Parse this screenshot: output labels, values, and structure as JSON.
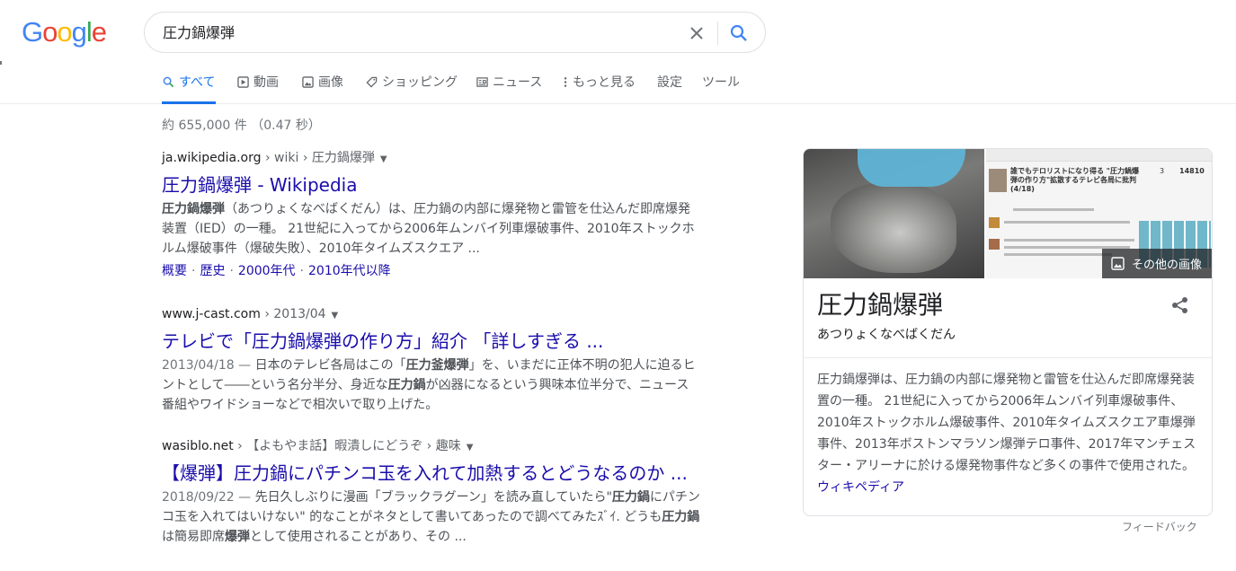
{
  "logo": {
    "letters": [
      {
        "ch": "G",
        "color": "#4285F4"
      },
      {
        "ch": "o",
        "color": "#EA4335"
      },
      {
        "ch": "o",
        "color": "#FBBC05"
      },
      {
        "ch": "g",
        "color": "#4285F4"
      },
      {
        "ch": "l",
        "color": "#34A853"
      },
      {
        "ch": "e",
        "color": "#EA4335"
      }
    ]
  },
  "search": {
    "query": "圧力鍋爆弾",
    "clear_icon": "close-icon",
    "search_icon": "search-icon"
  },
  "tabs": [
    {
      "label": "すべて",
      "icon": "search-icon",
      "active": true
    },
    {
      "label": "動画",
      "icon": "video-icon"
    },
    {
      "label": "画像",
      "icon": "image-icon"
    },
    {
      "label": "ショッピング",
      "icon": "tag-icon"
    },
    {
      "label": "ニュース",
      "icon": "news-icon"
    },
    {
      "label": "もっと見る",
      "icon": "more-vert-icon"
    },
    {
      "label": "設定"
    },
    {
      "label": "ツール"
    }
  ],
  "stats": "約 655,000 件 （0.47 秒）",
  "results": [
    {
      "domain": "ja.wikipedia.org",
      "path": " › wiki › 圧力鍋爆弾",
      "title": "圧力鍋爆弾 - Wikipedia",
      "snippet_bold": "圧力鍋爆弾",
      "snippet_rest": "（あつりょくなべばくだん）は、圧力鍋の内部に爆発物と雷管を仕込んだ即席爆発装置（IED）の一種。 21世紀に入ってから2006年ムンバイ列車爆破事件、2010年ストックホルム爆破事件（爆破失敗）、2010年タイムズスクエア ...",
      "sitelinks": [
        "概要",
        "歴史",
        "2000年代",
        "2010年代以降"
      ]
    },
    {
      "domain": "www.j-cast.com",
      "path": " › 2013/04",
      "title": "テレビで「圧力鍋爆弾の作り方」紹介 「詳しすぎる ...",
      "date": "2013/04/18 — ",
      "snippet_parts": [
        "日本のテレビ各局はこの「",
        "圧力釜爆弾",
        "」を、いまだに正体不明の犯人に迫るヒントとして――という名分半分、身近な",
        "圧力鍋",
        "が凶器になるという興味本位半分で、ニュース番組やワイドショーなどで相次いで取り上げた。"
      ]
    },
    {
      "domain": "wasiblo.net",
      "path": " › 【よもやま話】暇潰しにどうぞ › 趣味",
      "title": "【爆弾】圧力鍋にパチンコ玉を入れて加熱するとどうなるのか ...",
      "date": "2018/09/22 — ",
      "snippet_parts": [
        "先日久しぶりに漫画「ブラックラグーン」を読み直していたら\"",
        "圧力鍋",
        "にパチンコ玉を入れてはいけない\" 的なことがネタとして書いてあったので調べてみたｽﾞｲ. どうも",
        "圧力鍋",
        "は簡易即席",
        "爆弾",
        "として使用されることがあり、その ..."
      ]
    }
  ],
  "knowledge_panel": {
    "more_images": "その他の画像",
    "title": "圧力鍋爆弾",
    "subtitle": "あつりょくなべばくだん",
    "description": "圧力鍋爆弾は、圧力鍋の内部に爆発物と雷管を仕込んだ即席爆発装置の一種。 21世紀に入ってから2006年ムンバイ列車爆破事件、2010年ストックホルム爆破事件、2010年タイムズスクエア車爆弾事件、2013年ボストンマラソン爆弾テロ事件、2017年マンチェスター・アリーナに於ける爆発物事件など多くの事件で使用された。",
    "source": "ウィキペディア",
    "thumb_headline": "誰でもテロリストになり得る \"圧力鍋爆弾の作り方\"拡散するテレビ各局に批判 (4/18)",
    "thumb_counts": [
      "14810",
      "3"
    ]
  },
  "feedback": "フィードバック"
}
